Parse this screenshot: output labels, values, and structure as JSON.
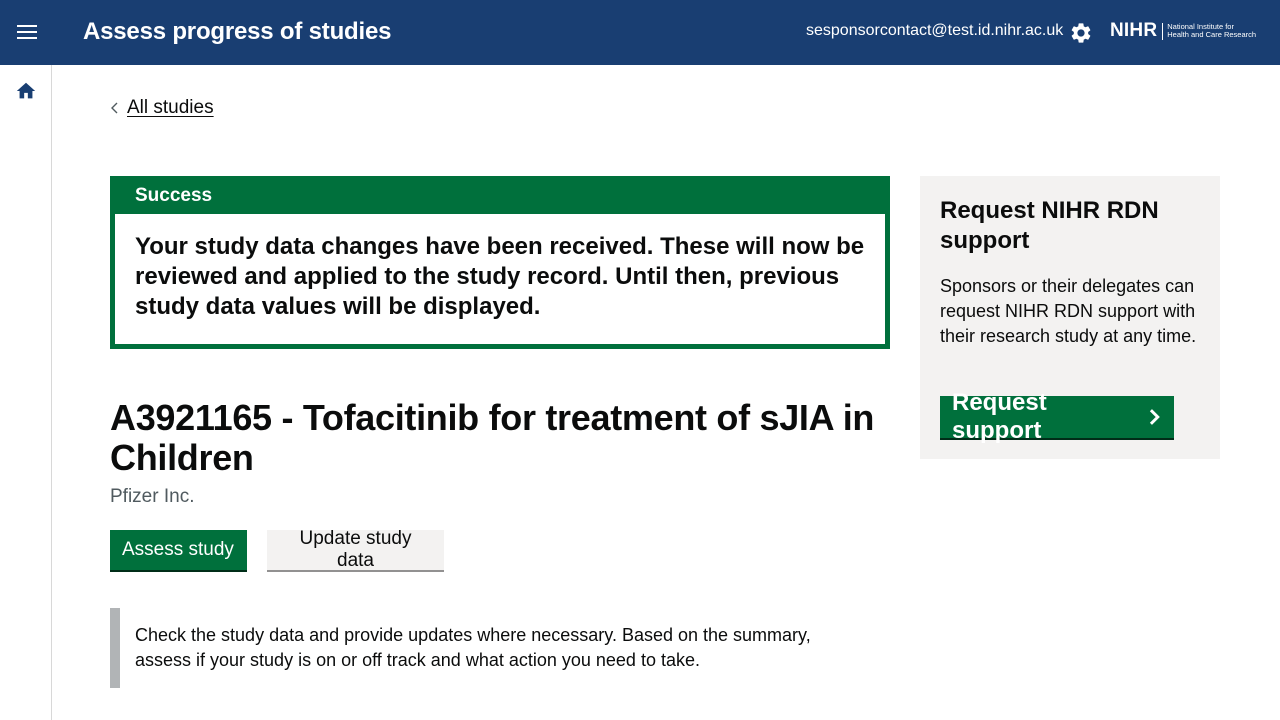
{
  "header": {
    "title": "Assess progress of studies",
    "user_email": "sesponsorcontact@test.id.nihr.ac.uk",
    "logo_text": "NIHR",
    "logo_subtitle_line1": "National Institute for",
    "logo_subtitle_line2": "Health and Care Research"
  },
  "nav": {
    "back_link": "All studies"
  },
  "banner": {
    "title": "Success",
    "message": "Your study data changes have been received. These will now be reviewed and applied to the study record. Until then, previous study data values will be displayed."
  },
  "study": {
    "title": "A3921165 - Tofacitinib for treatment of sJIA in Children",
    "sponsor": "Pfizer Inc."
  },
  "actions": {
    "assess_label": "Assess study",
    "update_label": "Update study data"
  },
  "inset": {
    "text": "Check the study data and provide updates where necessary. Based on the summary, assess if your study is on or off track and what action you need to take."
  },
  "aside": {
    "title": "Request NIHR RDN support",
    "text": "Sponsors or their delegates can request NIHR RDN support with their research study at any time.",
    "button_label": "Request support"
  },
  "colors": {
    "header_bg": "#193e72",
    "success_green": "#00703c",
    "aside_bg": "#f3f2f1"
  },
  "icons": [
    "menu-icon",
    "gear-icon",
    "home-icon",
    "chevron-left-icon",
    "chevron-right-icon"
  ]
}
